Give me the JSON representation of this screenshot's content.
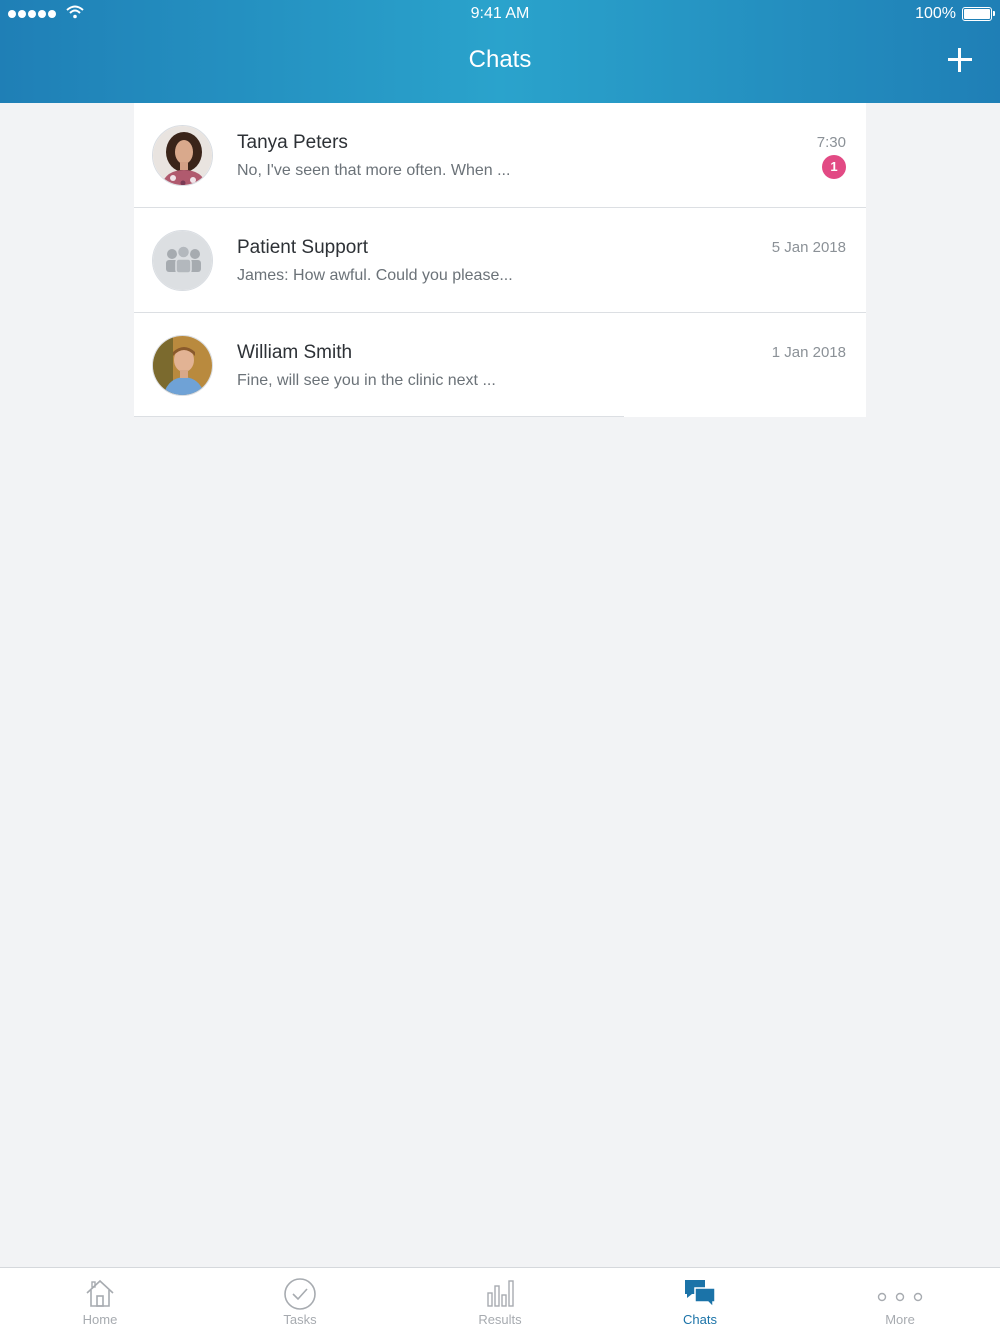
{
  "status_bar": {
    "time": "9:41 AM",
    "battery": "100%"
  },
  "nav": {
    "title": "Chats"
  },
  "chats": [
    {
      "name": "Tanya Peters",
      "preview": "No, I've seen that more often. When ...",
      "date": "7:30",
      "unread": "1"
    },
    {
      "name": "Patient Support",
      "preview": "James: How awful. Could you please...",
      "date": "5 Jan 2018"
    },
    {
      "name": "William Smith",
      "preview": "Fine, will see you in the clinic next ...",
      "date": "1 Jan 2018"
    }
  ],
  "tabs": [
    {
      "label": "Home",
      "icon": "home-icon"
    },
    {
      "label": "Tasks",
      "icon": "check-circle-icon"
    },
    {
      "label": "Results",
      "icon": "bar-chart-icon"
    },
    {
      "label": "Chats",
      "icon": "chat-bubbles-icon",
      "active": true
    },
    {
      "label": "More",
      "icon": "more-dots-icon"
    }
  ],
  "colors": {
    "accent": "#1b73a8",
    "header": "#2aa3cc",
    "badge": "#e24a84",
    "background": "#f2f3f5"
  }
}
